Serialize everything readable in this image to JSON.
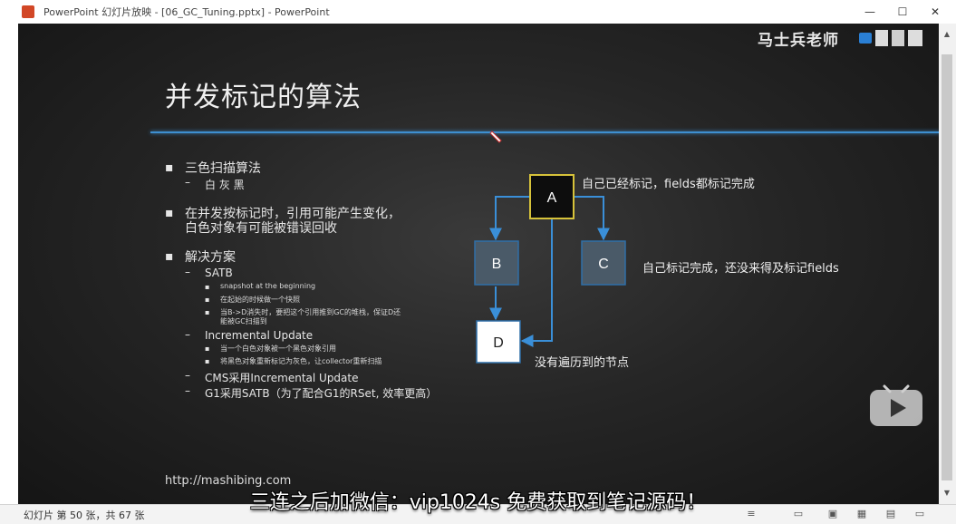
{
  "window": {
    "title": "PowerPoint 幻灯片放映 - [06_GC_Tuning.pptx] - PowerPoint",
    "minimize": "—",
    "maximize": "☐",
    "close": "✕"
  },
  "slide": {
    "brand": "马士兵老师",
    "title": "并发标记的算法",
    "bullets": {
      "b1": "三色扫描算法",
      "b1_sub": "白 灰 黑",
      "b2_line1": "在并发按标记时，引用可能产生变化，",
      "b2_line2": "白色对象有可能被错误回收",
      "b3": "解决方案",
      "satb": "SATB",
      "satb_1": "snapshot at the beginning",
      "satb_2": "在起始的时候做一个快照",
      "satb_3_line1": "当B->D消失时，要把这个引用推到GC的堆栈，保证D还",
      "satb_3_line2": "能被GC扫描到",
      "iu": "Incremental Update",
      "iu_1": "当一个白色对象被一个黑色对象引用",
      "iu_2": "将黑色对象重新标记为灰色，让collector重新扫描",
      "cms": "CMS采用Incremental Update",
      "g1": "G1采用SATB（为了配合G1的RSet, 效率更高）"
    },
    "markers": {
      "l1": "▪",
      "l2": "–",
      "l3": "▪"
    },
    "diagram": {
      "node_a": "A",
      "node_b": "B",
      "node_c": "C",
      "node_d": "D",
      "label_a": "自己已经标记，fields都标记完成",
      "label_c": "自己标记完成，还没来得及标记fields",
      "label_d": "没有遍历到的节点"
    },
    "url": "http://mashibing.com"
  },
  "status": {
    "slide_info": "幻灯片 第 50 张，共 67 张"
  },
  "subtitle": "三连之后加微信：vip1024s 免费获取到笔记源码！",
  "colors": {
    "accent_line": "#3e8fd0",
    "node_gray": "#4a5a68",
    "node_border": "#2f6fa8",
    "node_a_border": "#d6c23a",
    "arrow": "#3a8fd8"
  },
  "icons": [
    "powerpoint-icon",
    "pen-icon",
    "play-icon",
    "normal-view-icon",
    "slide-sorter-icon",
    "reading-view-icon",
    "slideshow-icon",
    "comments-icon",
    "notes-icon"
  ]
}
